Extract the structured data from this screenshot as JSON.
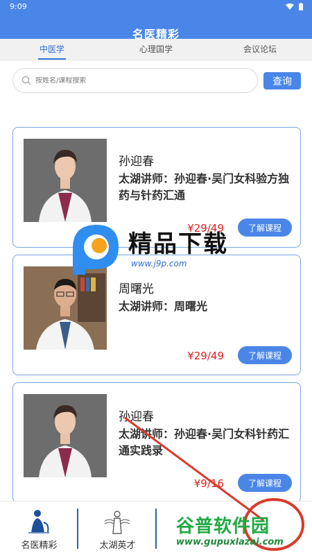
{
  "status_bar": {
    "time": "9:09"
  },
  "app": {
    "title": "名医精彩"
  },
  "tabs": [
    {
      "label": "中医学",
      "active": true
    },
    {
      "label": "心理国学",
      "active": false
    },
    {
      "label": "会议论坛",
      "active": false
    }
  ],
  "search": {
    "placeholder": "按姓名/课程搜索",
    "button_label": "查询"
  },
  "courses": [
    {
      "name": "孙迎春",
      "description": "太湖讲师：孙迎春·吴门女科验方独药与针药汇通",
      "price": "¥29/49",
      "button_label": "了解课程"
    },
    {
      "name": "周曙光",
      "description": "太湖讲师：周曙光",
      "price": "¥29/49",
      "button_label": "了解课程"
    },
    {
      "name": "孙迎春",
      "description": "太湖讲师：孙迎春·吴门女科针药汇通实践录",
      "price": "¥9/16",
      "button_label": "了解课程"
    }
  ],
  "bottom_nav": [
    {
      "label": "名医精彩",
      "icon": "doctor-icon"
    },
    {
      "label": "太湖英才",
      "icon": "scholar-icon"
    }
  ],
  "watermarks": {
    "center_text": "精品下载",
    "center_url": "www.j9p.com",
    "bottom_text": "谷普软件园",
    "bottom_url": "www.gupuxlazai.com"
  },
  "colors": {
    "accent": "#4a86e8",
    "price": "#e02020",
    "card_border": "#7aa5e8"
  }
}
